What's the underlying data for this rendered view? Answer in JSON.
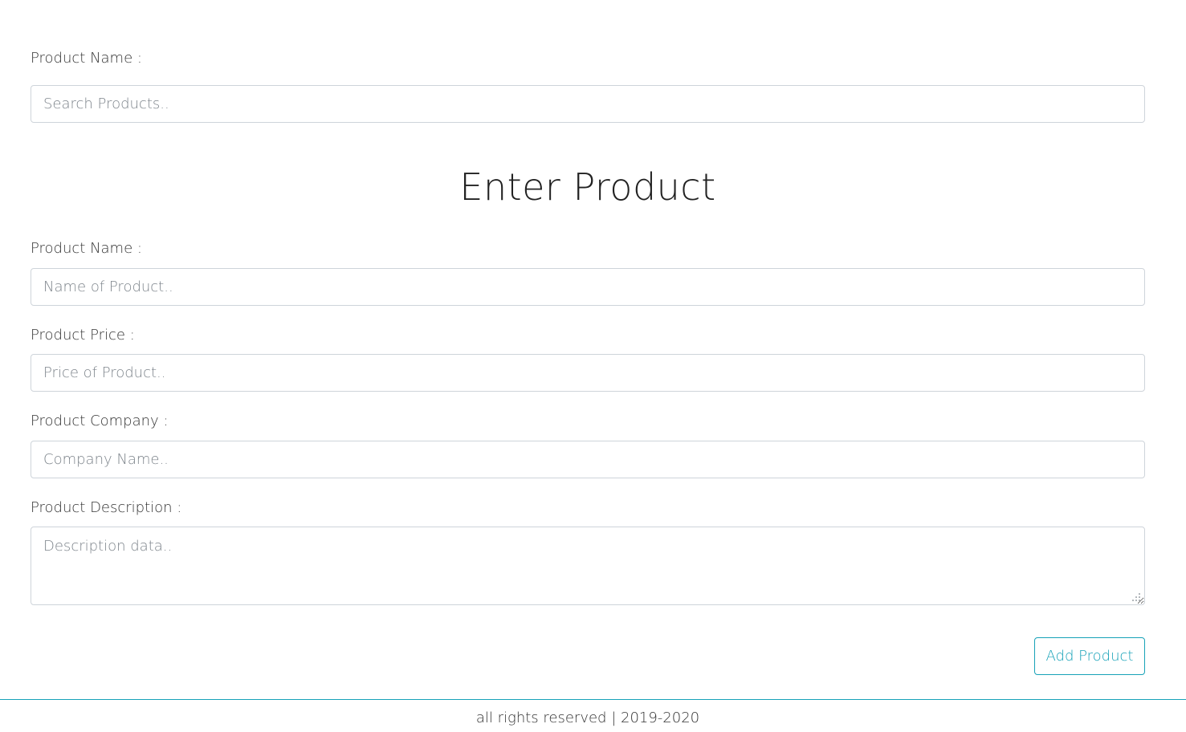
{
  "search": {
    "label": "Product Name :",
    "placeholder": "Search Products.."
  },
  "form": {
    "title": "Enter Product",
    "name_label": "Product Name :",
    "name_placeholder": "Name of Product..",
    "price_label": "Product Price :",
    "price_placeholder": "Price of Product..",
    "company_label": "Product Company :",
    "company_placeholder": "Company Name..",
    "description_label": "Product Description :",
    "description_placeholder": "Description data..",
    "submit_label": "Add Product"
  },
  "footer": {
    "text": "all rights reserved | 2019-2020"
  },
  "colors": {
    "accent": "#17a2b8",
    "border": "#ced4da",
    "placeholder": "#7d848b"
  }
}
